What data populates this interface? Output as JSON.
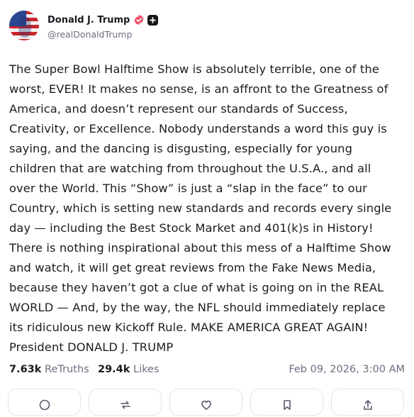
{
  "post": {
    "author": {
      "display_name": "Donald J. Trump",
      "handle": "@realDonaldTrump",
      "verified_icon": "verified-badge-icon",
      "extra_icon": "plus-badge-icon"
    },
    "text": "The Super Bowl Halftime Show is absolutely terrible, one of the\nworst, EVER! It makes no sense, is an affront to the Greatness of\nAmerica, and doesn’t represent our standards of Success,\nCreativity, or Excellence. Nobody understands a word this guy is\nsaying, and the dancing is disgusting, especially for young\nchildren that are watching from throughout the U.S.A., and all\nover the World. This “Show” is just a “slap in the face” to our\nCountry, which is setting new standards and records every single\nday — including the Best Stock Market and 401(k)s in History!\nThere is nothing inspirational about this mess of a Halftime Show\nand watch, it will get great reviews from the Fake News Media,\nbecause they haven’t got a clue of what is going on in the REAL\nWORLD — And, by the way, the NFL should immediately replace\nits ridiculous new Kickoff Rule. MAKE AMERICA GREAT AGAIN!\nPresident DONALD J. TRUMP",
    "stats": {
      "retruths_count": "7.63k",
      "retruths_label": "ReTruths",
      "likes_count": "29.4k",
      "likes_label": "Likes"
    },
    "timestamp": "Feb 09, 2026, 3:00 AM"
  },
  "actions": [
    "reply-icon",
    "retruth-icon",
    "like-icon",
    "bookmark-icon",
    "share-icon"
  ],
  "colors": {
    "verified": "#f0516b",
    "text": "#1c1c22",
    "muted": "#6b6f80",
    "border": "#e3e4ea"
  }
}
